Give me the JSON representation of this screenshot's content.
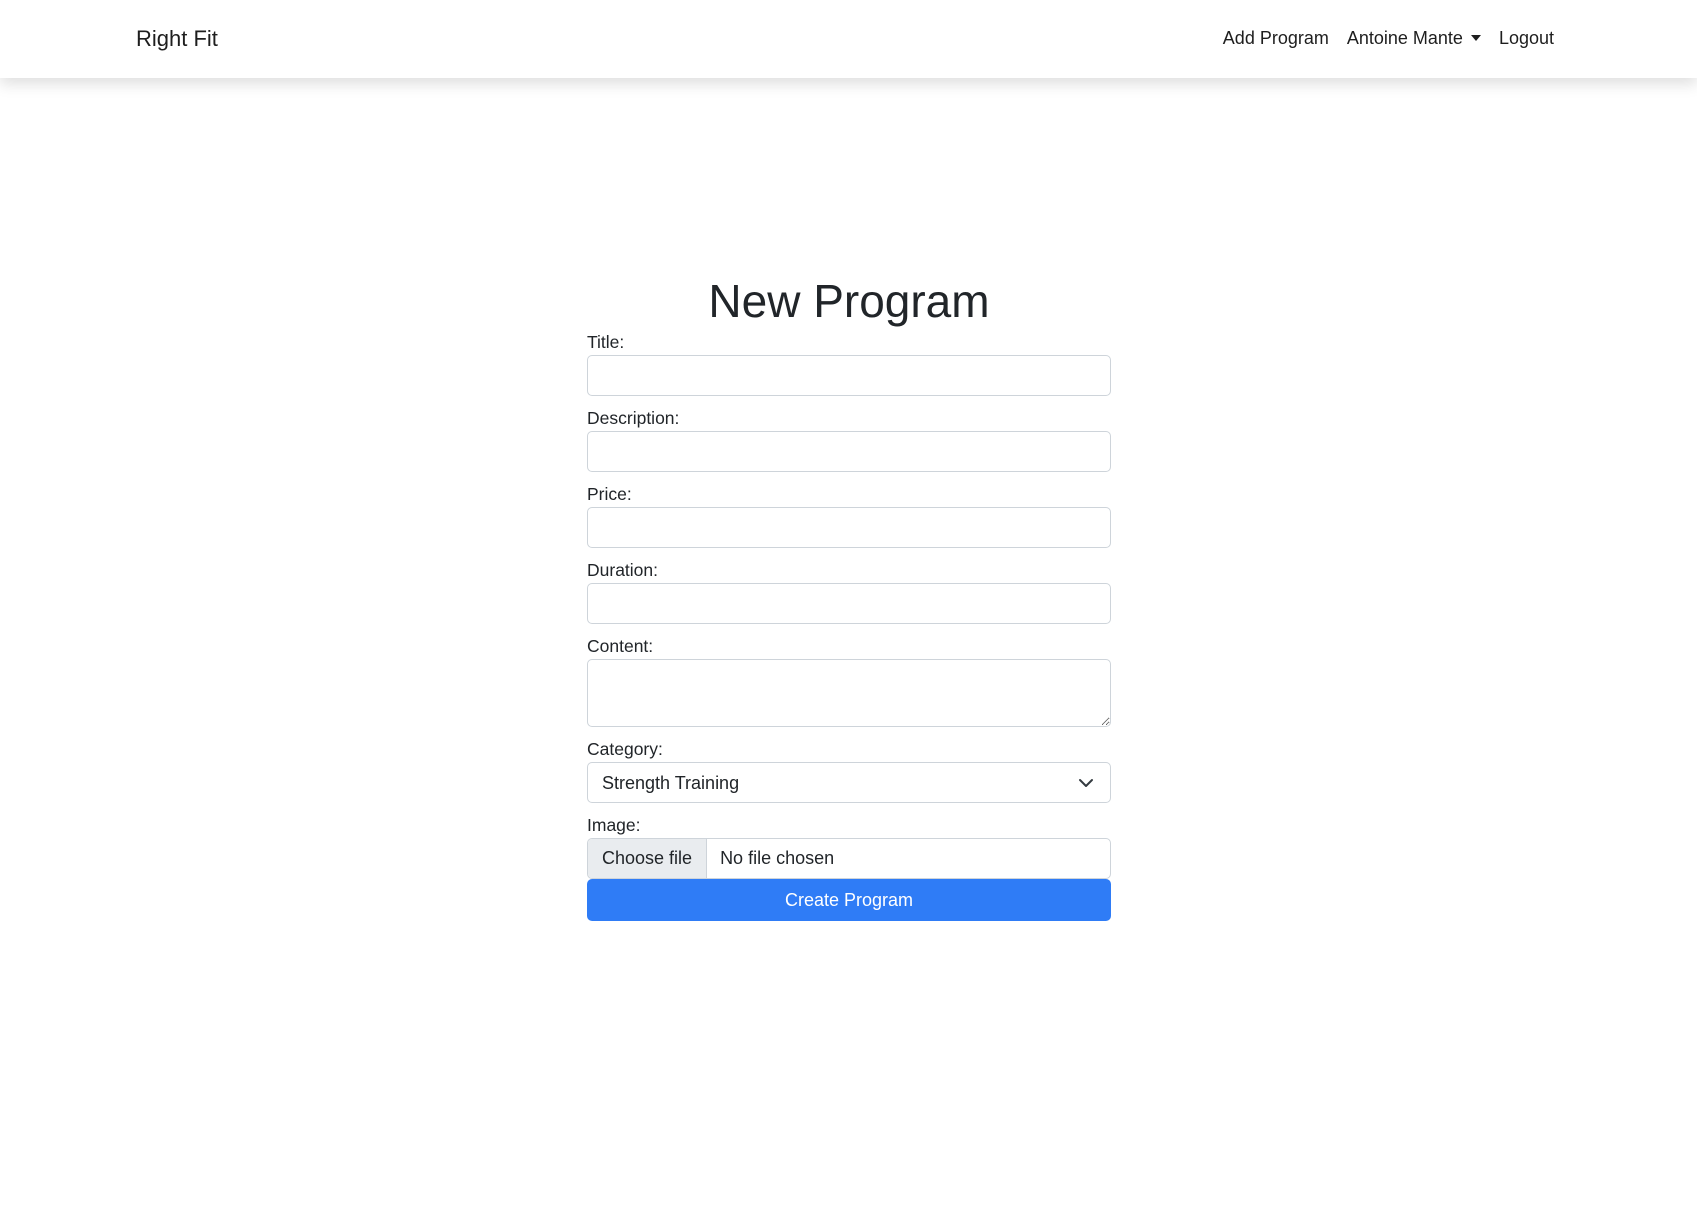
{
  "navbar": {
    "brand": "Right Fit",
    "links": {
      "add_program": "Add Program",
      "user_name": "Antoine Mante",
      "logout": "Logout"
    }
  },
  "form": {
    "heading": "New Program",
    "fields": {
      "title": {
        "label": "Title:",
        "value": ""
      },
      "description": {
        "label": "Description:",
        "value": ""
      },
      "price": {
        "label": "Price:",
        "value": ""
      },
      "duration": {
        "label": "Duration:",
        "value": ""
      },
      "content": {
        "label": "Content:",
        "value": ""
      },
      "category": {
        "label": "Category:",
        "selected": "Strength Training"
      },
      "image": {
        "label": "Image:",
        "button": "Choose file",
        "status": "No file chosen"
      }
    },
    "submit_label": "Create Program"
  },
  "colors": {
    "primary": "#2f7cf6",
    "text": "#212529",
    "border": "#ced4da"
  }
}
